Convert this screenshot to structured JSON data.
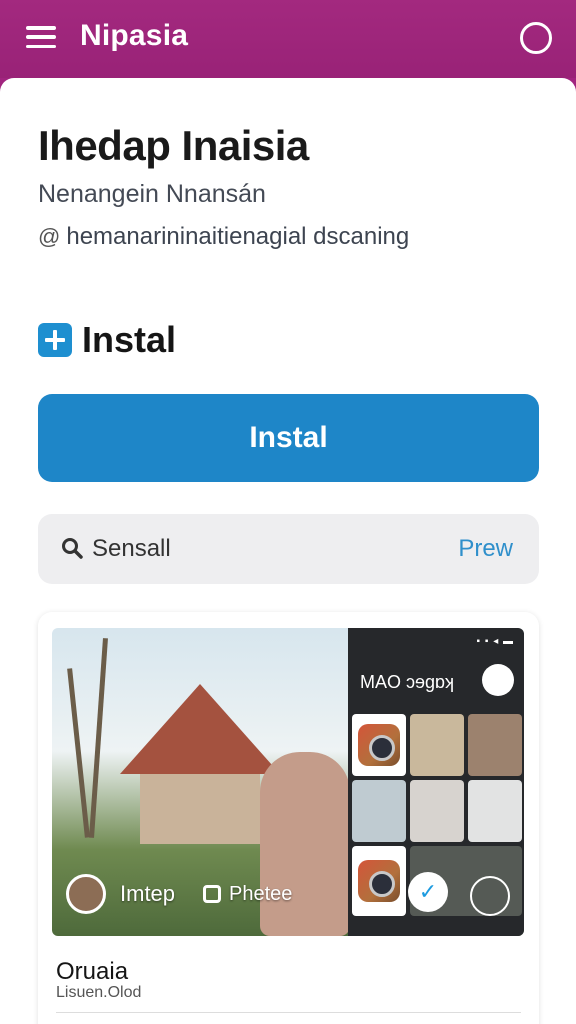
{
  "app": {
    "title": "Nipasia"
  },
  "header": {
    "headline": "Ihedap Inaisia",
    "subtitle": "Nenangein Nnansán",
    "handle": "hemanarininaitienagial dscaning"
  },
  "install": {
    "label": "Instal",
    "button_label": "Instal"
  },
  "search": {
    "placeholder": "Sensall",
    "action": "Prew"
  },
  "card": {
    "panel_title": "MAO ɔɘɡɒʞ",
    "caption_name": "Imtep",
    "caption_tag": "Phetee",
    "title": "Oruaia",
    "subtitle": "Lisuen.Olod"
  },
  "icons": [
    "menu-icon",
    "profile-icon",
    "at-icon",
    "store-icon",
    "search-icon",
    "camera-icon",
    "bird-icon",
    "play-icon",
    "photo-icon"
  ],
  "colors": {
    "header": "#a1247f",
    "primary": "#1e86c8",
    "link": "#2f8fcb"
  }
}
